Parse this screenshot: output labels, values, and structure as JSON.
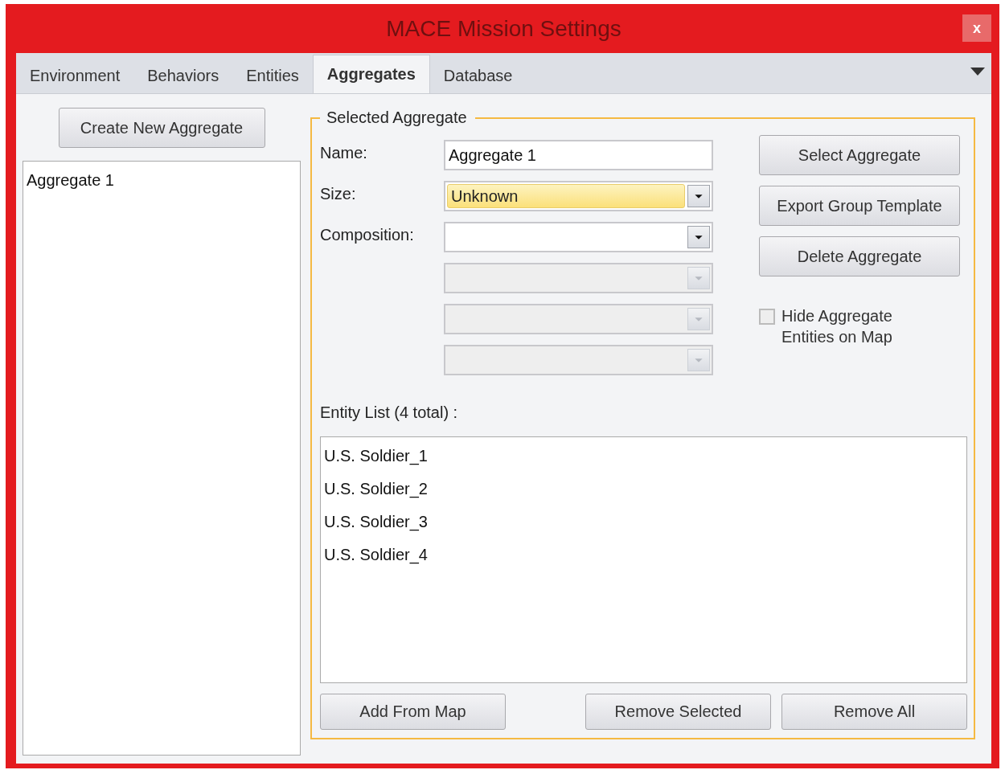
{
  "window": {
    "title": "MACE Mission Settings",
    "close_label": "x"
  },
  "tabs": [
    {
      "label": "Environment",
      "selected": false
    },
    {
      "label": "Behaviors",
      "selected": false
    },
    {
      "label": "Entities",
      "selected": false
    },
    {
      "label": "Aggregates",
      "selected": true
    },
    {
      "label": "Database",
      "selected": false
    }
  ],
  "left_panel": {
    "create_button": "Create New Aggregate",
    "aggregates": [
      {
        "label": "Aggregate 1",
        "selected": false
      }
    ]
  },
  "selected_aggregate": {
    "title": "Selected Aggregate",
    "fields": [
      {
        "kind": "text",
        "label": "Name:",
        "value": "Aggregate 1"
      },
      {
        "kind": "combo",
        "label": "Size:",
        "value": "Unknown",
        "highlighted": true,
        "disabled": false
      },
      {
        "kind": "combo",
        "label": "Composition:",
        "highlighted": false,
        "disabled": false
      },
      {
        "kind": "combo",
        "highlighted": false,
        "disabled": true
      },
      {
        "kind": "combo",
        "highlighted": false,
        "disabled": true
      },
      {
        "kind": "combo",
        "highlighted": false,
        "disabled": true
      }
    ],
    "buttons": [
      "Select Aggregate",
      "Export Group Template",
      "Delete Aggregate"
    ],
    "hide_checkbox": {
      "label": "Hide Aggregate Entities on Map",
      "checked": false
    },
    "entity_list_label": "Entity List (4 total) :",
    "entities": [
      {
        "label": "U.S. Soldier_1",
        "selected": false
      },
      {
        "label": "U.S. Soldier_2",
        "selected": false
      },
      {
        "label": "U.S. Soldier_3",
        "selected": false
      },
      {
        "label": "U.S. Soldier_4",
        "selected": false
      }
    ],
    "bottom_buttons": [
      "Add From Map",
      "Remove Selected",
      "Remove All"
    ]
  }
}
